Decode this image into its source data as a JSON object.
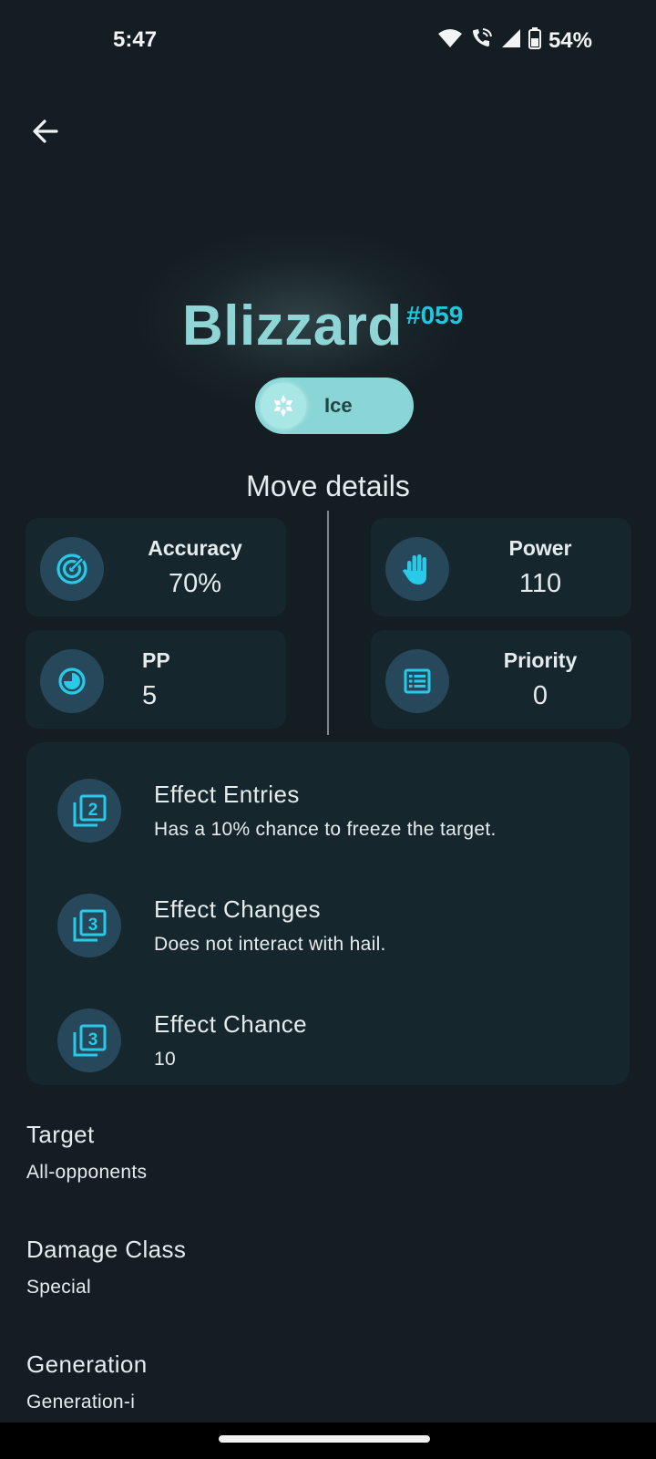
{
  "status_bar": {
    "time": "5:47",
    "battery": "54%"
  },
  "move": {
    "name": "Blizzard",
    "number": "#059",
    "type": "Ice"
  },
  "section_title": "Move details",
  "stats": {
    "accuracy": {
      "label": "Accuracy",
      "value": "70%"
    },
    "power": {
      "label": "Power",
      "value": "110"
    },
    "pp": {
      "label": "PP",
      "value": "5"
    },
    "priority": {
      "label": "Priority",
      "value": "0"
    }
  },
  "effects": [
    {
      "title": "Effect Entries",
      "text": "Has a 10% chance to freeze the target.",
      "icon": "filter-2-icon"
    },
    {
      "title": "Effect Changes",
      "text": "Does not interact with hail.",
      "icon": "filter-3-icon"
    },
    {
      "title": "Effect Chance",
      "text": "10",
      "icon": "filter-3-icon"
    }
  ],
  "info": {
    "target": {
      "title": "Target",
      "value": "All-opponents"
    },
    "damage_class": {
      "title": "Damage Class",
      "value": "Special"
    },
    "generation": {
      "title": "Generation",
      "value": "Generation-i"
    }
  },
  "colors": {
    "background": "#141d22",
    "card": "#15262c",
    "accent": "#1fc6e0",
    "title": "#8fd5d6",
    "type_chip": "#8ad6d7"
  }
}
